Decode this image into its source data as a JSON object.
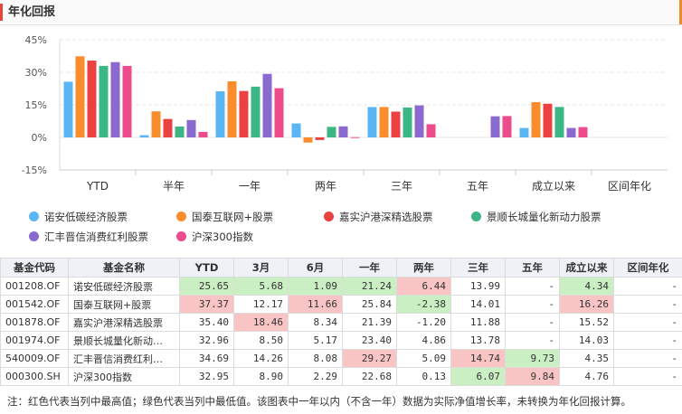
{
  "header": {
    "title": "年化回报"
  },
  "chart_data": {
    "type": "bar",
    "categories": [
      "YTD",
      "半年",
      "一年",
      "两年",
      "三年",
      "五年",
      "成立以来",
      "区间年化"
    ],
    "ylim": [
      -15,
      45
    ],
    "yticks": [
      "45%",
      "30%",
      "15%",
      "0%",
      "-15%"
    ],
    "grid": true,
    "legend_position": "bottom",
    "series": [
      {
        "name": "诺安低碳经济股票",
        "color": "#5ab5f5",
        "values": [
          25.65,
          1.0,
          21.24,
          6.44,
          13.99,
          null,
          4.34,
          null
        ]
      },
      {
        "name": "国泰互联网+股票",
        "color": "#fb8c2b",
        "values": [
          37.37,
          12.0,
          25.84,
          -2.38,
          14.01,
          null,
          16.26,
          null
        ]
      },
      {
        "name": "嘉实沪港深精选股票",
        "color": "#ec4141",
        "values": [
          35.4,
          8.5,
          21.39,
          -1.2,
          11.88,
          null,
          15.52,
          null
        ]
      },
      {
        "name": "景顺长城量化新动力股票",
        "color": "#3db686",
        "values": [
          32.96,
          5.0,
          23.4,
          4.86,
          13.78,
          null,
          14.03,
          null
        ]
      },
      {
        "name": "汇丰晋信消费红利股票",
        "color": "#8b6ad0",
        "values": [
          34.69,
          8.0,
          29.27,
          5.09,
          14.74,
          9.73,
          4.35,
          null
        ]
      },
      {
        "name": "沪深300指数",
        "color": "#ec4b8c",
        "values": [
          32.95,
          2.5,
          22.68,
          0.13,
          6.07,
          9.84,
          4.76,
          null
        ]
      }
    ]
  },
  "table": {
    "headers": [
      "基金代码",
      "基金名称",
      "YTD",
      "3月",
      "6月",
      "一年",
      "两年",
      "三年",
      "五年",
      "成立以来",
      "区间年化"
    ],
    "rows": [
      {
        "cells": [
          "001208.OF",
          "诺安低碳经济股票",
          "25.65",
          "5.68",
          "1.09",
          "21.24",
          "6.44",
          "13.99",
          "-",
          "4.34",
          "-"
        ],
        "marks": [
          "",
          "",
          "lo",
          "lo",
          "lo",
          "lo",
          "hi",
          "",
          "",
          "lo",
          ""
        ]
      },
      {
        "cells": [
          "001542.OF",
          "国泰互联网+股票",
          "37.37",
          "12.17",
          "11.66",
          "25.84",
          "-2.38",
          "14.01",
          "-",
          "16.26",
          "-"
        ],
        "marks": [
          "",
          "",
          "hi",
          "",
          "hi",
          "",
          "lo",
          "",
          "",
          "hi",
          ""
        ]
      },
      {
        "cells": [
          "001878.OF",
          "嘉实沪港深精选股票",
          "35.40",
          "18.46",
          "8.34",
          "21.39",
          "-1.20",
          "11.88",
          "-",
          "15.52",
          "-"
        ],
        "marks": [
          "",
          "",
          "",
          "hi",
          "",
          "",
          "",
          "",
          "",
          "",
          ""
        ]
      },
      {
        "cells": [
          "001974.OF",
          "景顺长城量化新动…",
          "32.96",
          "8.50",
          "5.17",
          "23.40",
          "4.86",
          "13.78",
          "-",
          "14.03",
          "-"
        ],
        "marks": [
          "",
          "",
          "",
          "",
          "",
          "",
          "",
          "",
          "",
          "",
          ""
        ]
      },
      {
        "cells": [
          "540009.OF",
          "汇丰晋信消费红利…",
          "34.69",
          "14.26",
          "8.08",
          "29.27",
          "5.09",
          "14.74",
          "9.73",
          "4.35",
          "-"
        ],
        "marks": [
          "",
          "",
          "",
          "",
          "",
          "hi",
          "",
          "hi",
          "lo",
          "",
          ""
        ]
      },
      {
        "cells": [
          "000300.SH",
          "沪深300指数",
          "32.95",
          "8.90",
          "2.29",
          "22.68",
          "0.13",
          "6.07",
          "9.84",
          "4.76",
          "-"
        ],
        "marks": [
          "",
          "",
          "",
          "",
          "",
          "",
          "",
          "lo",
          "hi",
          "",
          ""
        ]
      }
    ]
  },
  "note": "注：红色代表当列中最高值；绿色代表当列中最低值。该图表中一年以内（不含一年）数据为实际净值增长率，未转换为年化回报计算。"
}
